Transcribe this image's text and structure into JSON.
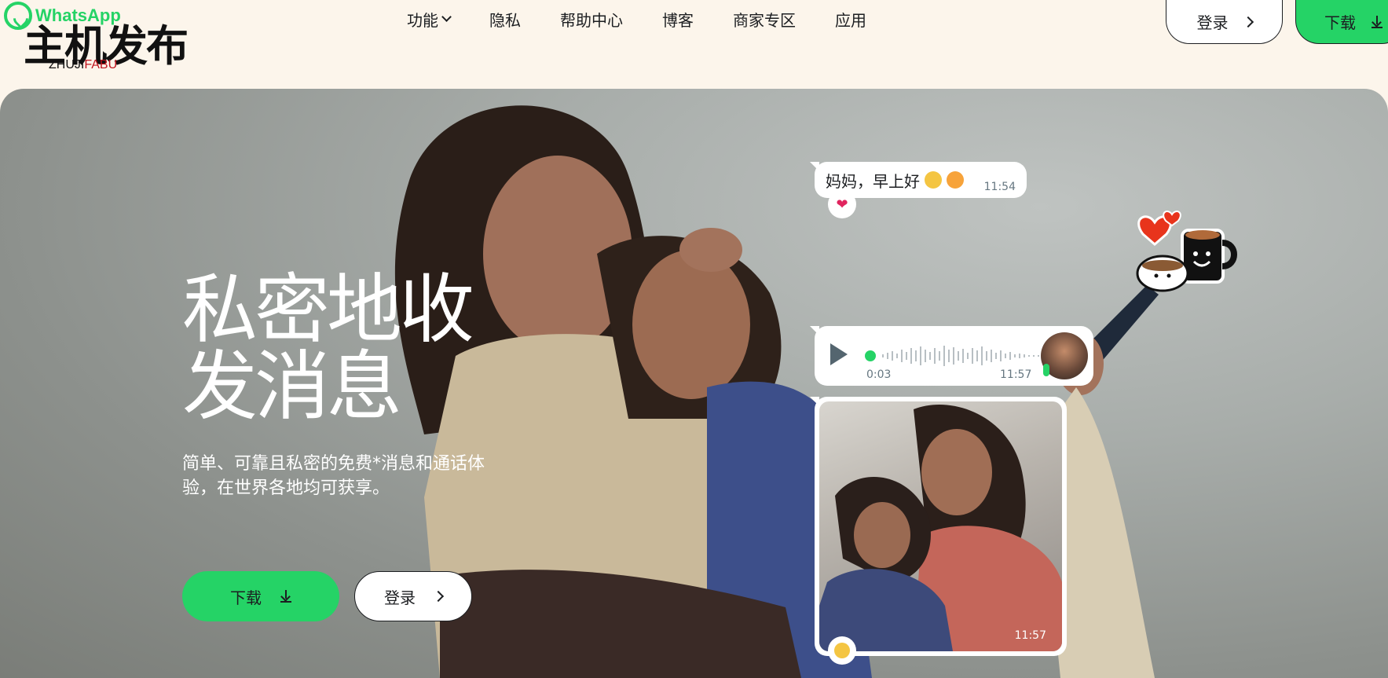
{
  "brand": {
    "whatsapp": "WhatsApp",
    "cn_logo": "主机发布",
    "latin_logo_a": "ZHUJI",
    "latin_logo_b": "FABU",
    "accent_color": "#25d366"
  },
  "nav": {
    "items": [
      {
        "label": "功能",
        "has_dropdown": true
      },
      {
        "label": "隐私"
      },
      {
        "label": "帮助中心"
      },
      {
        "label": "博客"
      },
      {
        "label": "商家专区"
      },
      {
        "label": "应用"
      }
    ],
    "login_label": "登录",
    "download_label": "下载"
  },
  "hero": {
    "title_line1": "私密地收",
    "title_line2": "发消息",
    "subtitle": "简单、可靠且私密的免费*消息和通话体验，在世界各地均可获享。",
    "download_label": "下载",
    "login_label": "登录"
  },
  "chat": {
    "message1": "妈妈，早上好",
    "message1_time": "11:54",
    "voice_elapsed": "0:03",
    "voice_time": "11:57",
    "photo_time": "11:57"
  },
  "icons": [
    "whatsapp-icon",
    "chevron-down-icon",
    "chevron-right-icon",
    "download-icon",
    "heart-icon",
    "play-icon",
    "mic-icon",
    "coffee-sticker-icon"
  ]
}
